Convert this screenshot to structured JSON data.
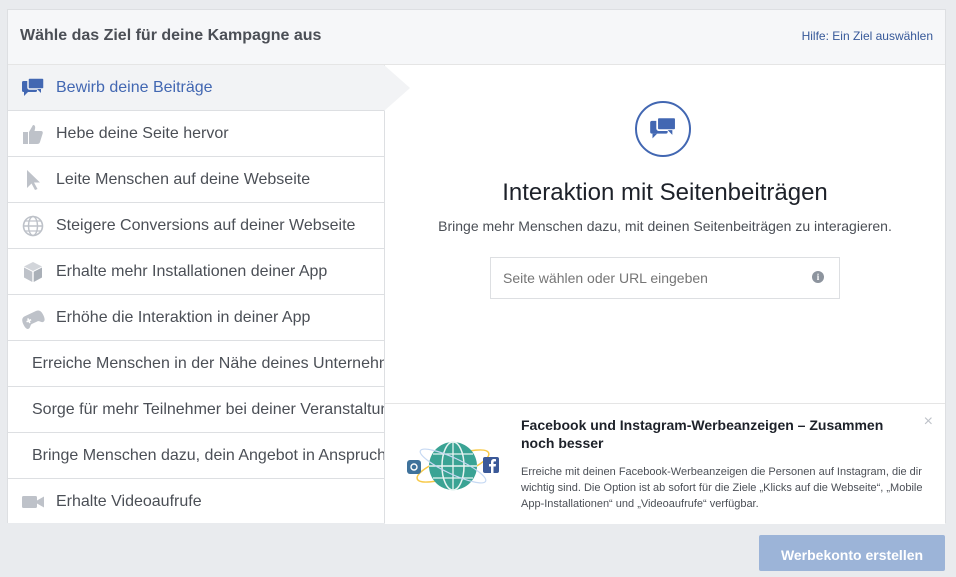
{
  "header": {
    "title": "Wähle das Ziel für deine Kampagne aus",
    "help_link": "Hilfe: Ein Ziel auswählen"
  },
  "sidebar": {
    "items": [
      {
        "label": "Bewirb deine Beiträge",
        "icon": "speech-bubbles-icon",
        "active": true
      },
      {
        "label": "Hebe deine Seite hervor",
        "icon": "thumbs-up-icon"
      },
      {
        "label": "Leite Menschen auf deine Webseite",
        "icon": "cursor-icon"
      },
      {
        "label": "Steigere Conversions auf deiner Webseite",
        "icon": "globe-icon"
      },
      {
        "label": "Erhalte mehr Installationen deiner App",
        "icon": "cube-icon"
      },
      {
        "label": "Erhöhe die Interaktion in deiner App",
        "icon": "gamepad-icon"
      },
      {
        "label": "Erreiche Menschen in der Nähe deines Unternehmens"
      },
      {
        "label": "Sorge für mehr Teilnehmer bei deiner Veranstaltung"
      },
      {
        "label": "Bringe Menschen dazu, dein Angebot in Anspruch zu nehmen"
      },
      {
        "label": "Erhalte Videoaufrufe",
        "icon": "video-camera-icon"
      }
    ]
  },
  "main": {
    "icon": "speech-bubbles-icon",
    "title": "Interaktion mit Seitenbeiträgen",
    "description": "Bringe mehr Menschen dazu, mit deinen Seitenbeiträgen zu interagieren.",
    "input_placeholder": "Seite wählen oder URL eingeben",
    "input_value": ""
  },
  "promo": {
    "title": "Facebook und Instagram-Werbeanzeigen – Zusammen noch besser",
    "text": "Erreiche mit deinen Facebook-Werbeanzeigen die Personen auf Instagram, die dir wichtig sind. Die Option ist ab sofort für die Ziele „Klicks auf die Webseite“, „Mobile App-Installationen“ und „Videoaufrufe“ verfügbar.",
    "close": "×",
    "art_icons": [
      "instagram-icon",
      "globe-icon",
      "facebook-icon"
    ]
  },
  "footer": {
    "create_button": "Werbekonto erstellen"
  },
  "colors": {
    "accent": "#4267b2",
    "button_disabled": "#9cb4d8",
    "icon_grey": "#bec2c9"
  }
}
